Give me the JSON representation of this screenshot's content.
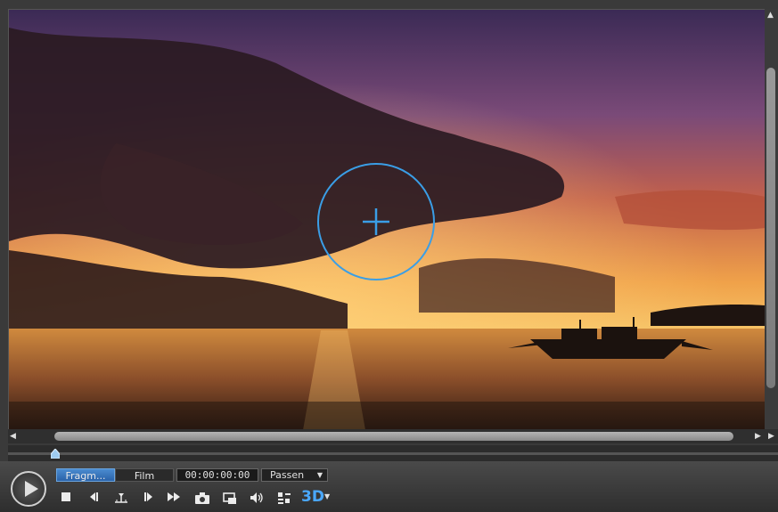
{
  "tabs": [
    {
      "label": "Fragm..."
    },
    {
      "label": "Film"
    }
  ],
  "timecode": "00:00:00:00",
  "fit_dropdown": {
    "label": "Passen",
    "arrow": "▼"
  },
  "badge_3d": {
    "label": "3D",
    "arrow": "▼"
  },
  "scroll_arrows": {
    "up": "▲",
    "left": "◀",
    "right": "▶",
    "end": "▶"
  },
  "icons": {
    "play": "play-icon",
    "stop": "stop-icon",
    "prev_frame": "previous-frame-icon",
    "split": "split-clip-icon",
    "next_frame": "next-frame-icon",
    "fast_forward": "fast-forward-icon",
    "snapshot": "camera-icon",
    "screen": "screen-mode-icon",
    "volume": "volume-icon",
    "settings": "display-settings-icon",
    "focus": "crosshair-icon"
  },
  "colors": {
    "accent": "#3a9ee6",
    "tab_active": "#3a78c0",
    "badge_3d": "#4aa8ff"
  }
}
